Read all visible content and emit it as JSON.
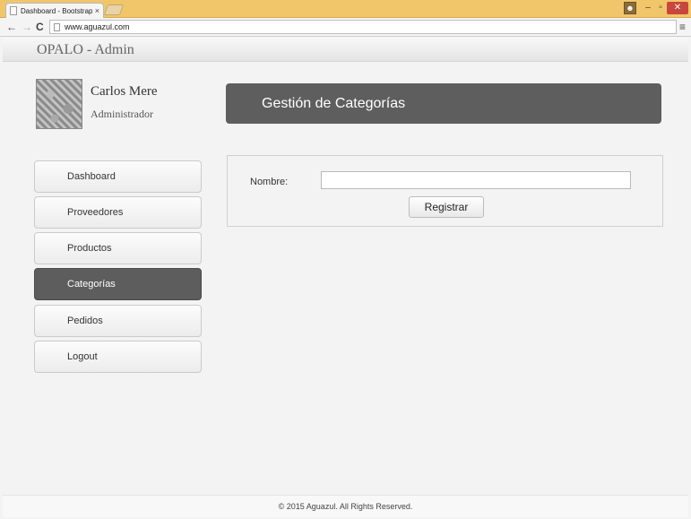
{
  "browser": {
    "tab_title": "Dashboard - Bootstrap Ac",
    "tab_close": "×",
    "url": "www.aguazul.com",
    "nav_back": "←",
    "nav_forward": "→",
    "nav_reload": "C",
    "menu": "≡",
    "window_min": "–",
    "window_max": "▫",
    "window_close": "✕",
    "user_icon": "user-icon"
  },
  "navbar": {
    "brand": "OPALO - Admin"
  },
  "profile": {
    "name": "Carlos Mere",
    "role": "Administrador"
  },
  "sidebar": {
    "items": [
      {
        "label": "Dashboard",
        "active": false
      },
      {
        "label": "Proveedores",
        "active": false
      },
      {
        "label": "Productos",
        "active": false
      },
      {
        "label": "Categorías",
        "active": true
      },
      {
        "label": "Pedidos",
        "active": false
      },
      {
        "label": "Logout",
        "active": false
      }
    ]
  },
  "main": {
    "header": "Gestión de Categorías",
    "form": {
      "name_label": "Nombre:",
      "name_value": "",
      "submit_label": "Registrar"
    }
  },
  "footer": {
    "text": "© 2015 Aguazul. All Rights Reserved."
  },
  "colors": {
    "active_menu": "#5d5d5d",
    "header_bg": "#5e5e5e",
    "chrome": "#f1c66a",
    "close_btn": "#c9463d"
  }
}
